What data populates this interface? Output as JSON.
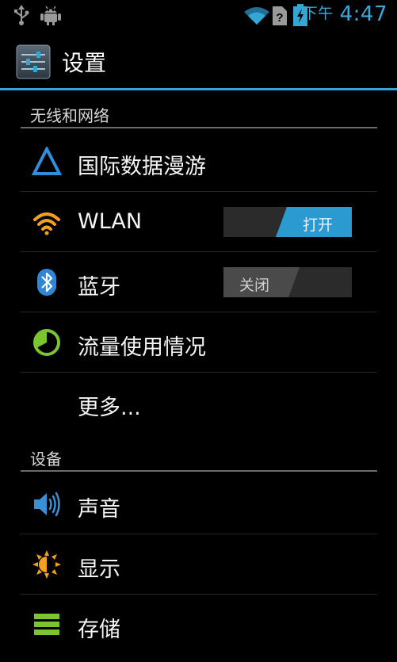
{
  "status_bar": {
    "ampm": "下午",
    "time": "4:47",
    "icons": [
      "usb-icon",
      "android-debug-icon",
      "wifi-icon",
      "no-sim-icon",
      "battery-charging-icon"
    ]
  },
  "action_bar": {
    "title": "设置",
    "icon": "settings-sliders-icon"
  },
  "sections": [
    {
      "header": "无线和网络",
      "items": [
        {
          "label": "国际数据漫游",
          "icon": "roaming-triangle-icon"
        },
        {
          "label": "WLAN",
          "icon": "wifi-icon",
          "toggle": "打开",
          "toggle_on": true
        },
        {
          "label": "蓝牙",
          "icon": "bluetooth-icon",
          "toggle": "关闭",
          "toggle_on": false
        },
        {
          "label": "流量使用情况",
          "icon": "data-usage-icon"
        },
        {
          "label": "更多..."
        }
      ]
    },
    {
      "header": "设备",
      "items": [
        {
          "label": "声音",
          "icon": "volume-icon"
        },
        {
          "label": "显示",
          "icon": "brightness-icon"
        },
        {
          "label": "存储",
          "icon": "storage-icon"
        }
      ]
    }
  ],
  "colors": {
    "accent": "#33a6d6",
    "background": "#000000",
    "toggle_on": "#2b9ad1",
    "toggle_off": "#4a4a4a"
  }
}
